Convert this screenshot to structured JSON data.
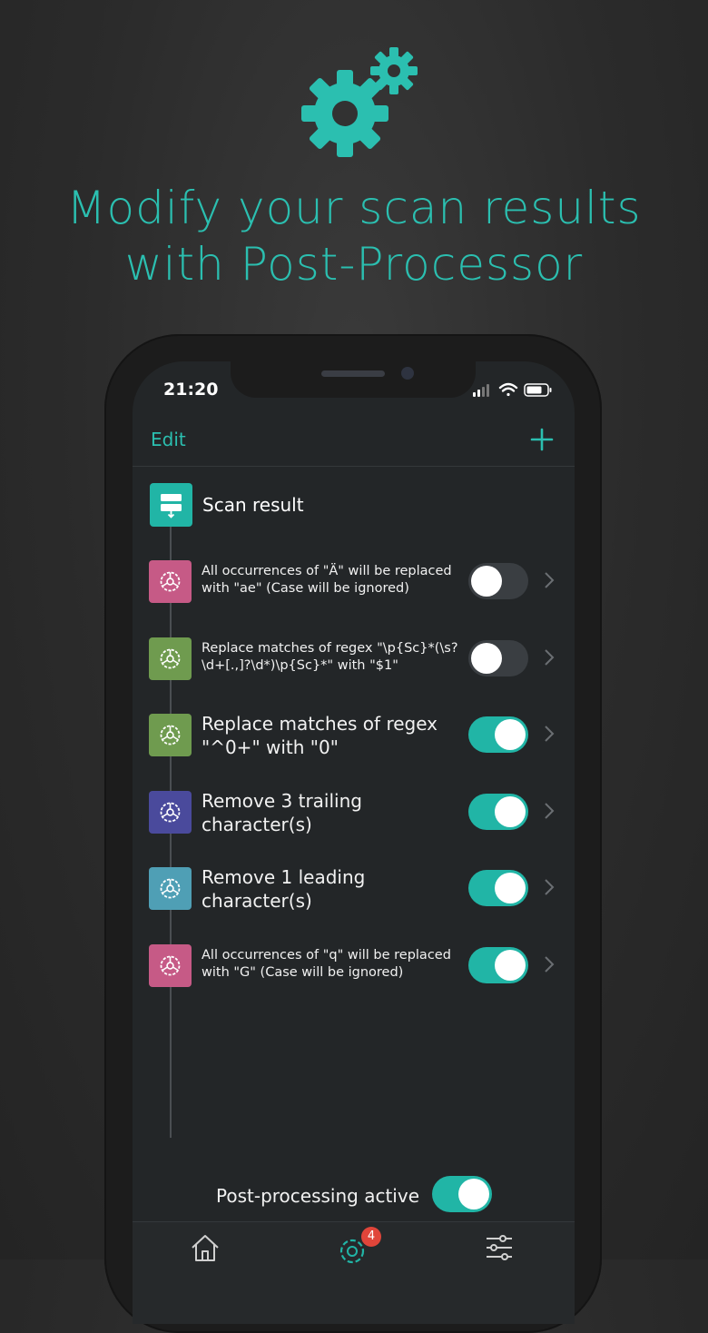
{
  "headline": {
    "line1": "Modify your scan results",
    "line2": "with Post-Processor"
  },
  "status_bar": {
    "time": "21:20"
  },
  "navbar": {
    "edit_label": "Edit",
    "add_icon": "plus-icon"
  },
  "source": {
    "label": "Scan result",
    "icon": "scan-result-icon"
  },
  "rules": [
    {
      "text": "All occurrences of \"Ä\" will be replaced with \"ae\" (Case will be ignored)",
      "size": "small",
      "enabled": false,
      "color": "#c65a86"
    },
    {
      "text": "Replace matches of regex \"\\p{Sc}*(\\s?\\d+[.,]?\\d*)\\p{Sc}*\" with \"$1\"",
      "size": "small",
      "enabled": false,
      "color": "#6f9b4f"
    },
    {
      "text": "Replace matches of regex \"^0+\" with \"0\"",
      "size": "big",
      "enabled": true,
      "color": "#6f9b4f"
    },
    {
      "text": "Remove 3 trailing character(s)",
      "size": "big",
      "enabled": true,
      "color": "#4a4a9c"
    },
    {
      "text": "Remove 1 leading character(s)",
      "size": "big",
      "enabled": true,
      "color": "#4f9fb5"
    },
    {
      "text": "All occurrences of \"q\" will be replaced with \"G\" (Case will be ignored)",
      "size": "small",
      "enabled": true,
      "color": "#c65a86"
    }
  ],
  "footer": {
    "label": "Post-processing active",
    "enabled": true
  },
  "tabbar": {
    "badge_count": "4",
    "icons": [
      "home-icon",
      "post-processor-icon",
      "settings-sliders-icon"
    ]
  },
  "colors": {
    "accent": "#2bbfb0",
    "toggle_on": "#21b5a6",
    "background": "#2b2b2b",
    "screen": "#232628"
  }
}
